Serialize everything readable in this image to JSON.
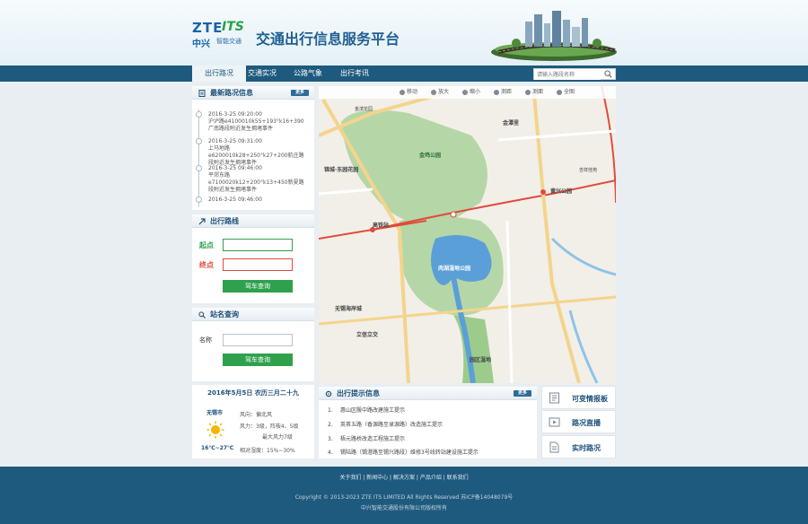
{
  "header": {
    "logo_zte": "ZTE",
    "logo_its": "ITS",
    "logo_cn": "中兴",
    "logo_sub": "智能交通",
    "title": "交通出行信息服务平台"
  },
  "nav": {
    "items": [
      {
        "label": "出行路况",
        "active": true
      },
      {
        "label": "交通实况",
        "active": false
      },
      {
        "label": "公路气象",
        "active": false
      },
      {
        "label": "出行考讯",
        "active": false
      }
    ],
    "search_placeholder": "请输入路段名称"
  },
  "events": {
    "title": "最新路况信息",
    "more": "更多",
    "items": [
      {
        "time": "2016-3-25  09:20:00",
        "text": "沪泸路e4100010k55+193°k16+390广南路段附近发生拥堵事件"
      },
      {
        "time": "2016-3-25  09:31:00",
        "text": "上马地路e6200010k28+250°k27+200航庄路段附近发生拥堵事件"
      },
      {
        "time": "2016-3-25  09:46:00",
        "text": "平郊东路e7100020k12+200°k13+450新夏路段附近发生拥堵事件"
      },
      {
        "time": "2016-3-25  09:46:00",
        "text": ""
      }
    ]
  },
  "route": {
    "title": "出行路线",
    "start_label": "起点",
    "end_label": "终点",
    "button": "驾车查询"
  },
  "station": {
    "title": "站名查询",
    "name_label": "名称",
    "button": "驾车查询"
  },
  "map": {
    "tools": [
      "移动",
      "放大",
      "缩小",
      "测距",
      "测面",
      "全图"
    ],
    "labels": {
      "park1": "金鸡公园",
      "park2": "肉湖湿地公园",
      "area1": "锦城·东园花园",
      "area2": "无锡海岸城",
      "area3": "金潭里",
      "area4": "金滨花园",
      "area5": "立信立交",
      "area6": "高铁站",
      "area7": "园区湿地",
      "area8": "吉祥佳苑",
      "area9": "黄兴公园"
    }
  },
  "weather": {
    "date": "2016年5月5日 农历三月二十九",
    "city": "无锡市",
    "temp": "16℃~27℃",
    "wind_dir": "风向：偏北风",
    "wind_level": "风力：3级，阵桉4、5级",
    "wind_max": "最大风力7级",
    "humidity": "相对湿度：15%~30%"
  },
  "notices": {
    "title": "出行提示信息",
    "more": "更多",
    "items": [
      {
        "num": "1.",
        "text": "惠山区殷中路改建施工提示"
      },
      {
        "num": "2.",
        "text": "英茶五路（香源路至录源路）改造施工提示"
      },
      {
        "num": "3.",
        "text": "梧元路桥改造工程施工提示"
      },
      {
        "num": "4.",
        "text": "锡陆路（锡澄路至锡兴路段）维修3号线转站建设施工提示"
      }
    ]
  },
  "side_buttons": [
    {
      "label": "可变情报板",
      "icon": "board-icon"
    },
    {
      "label": "路况直播",
      "icon": "play-icon"
    },
    {
      "label": "实时路况",
      "icon": "document-icon"
    }
  ],
  "footer": {
    "links": "关于我们 | 新闻中心 | 解决方案 | 产品介绍 | 联系我们",
    "copyright": "Copyright © 2013-2023 ZTE ITS LIMITED All Rights Reserved   苏ICP备14048079号",
    "company": "中兴智能交通股份有限公司版权所有"
  },
  "colors": {
    "primary": "#1e5a7e",
    "accent_green": "#2fa14c",
    "accent_red": "#e24a3b"
  }
}
